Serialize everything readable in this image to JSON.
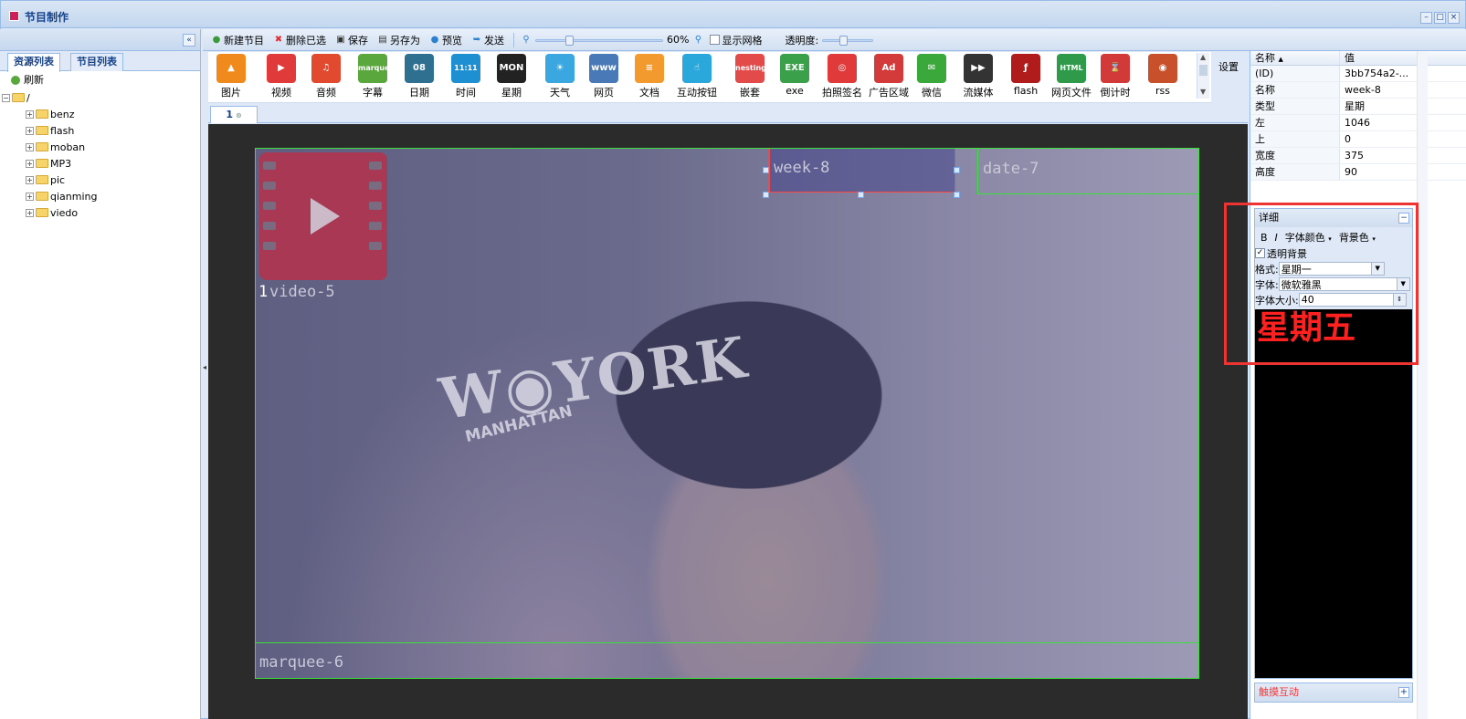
{
  "window": {
    "title": "节目制作",
    "controls": [
      "–",
      "□",
      "×"
    ]
  },
  "left_panel": {
    "collapse_glyph": "«",
    "tabs": [
      "资源列表",
      "节目列表"
    ],
    "refresh_label": "刷新",
    "root_label": "/",
    "folders": [
      "benz",
      "flash",
      "moban",
      "MP3",
      "pic",
      "qianming",
      "viedo"
    ]
  },
  "toolbar": {
    "new_program": "新建节目",
    "delete_selected": "删除已选",
    "save": "保存",
    "save_as": "另存为",
    "preview": "预览",
    "send": "发送",
    "zoom_value": "60%",
    "zoom_level": 0.25,
    "show_grid": "显示网格",
    "show_grid_checked": false,
    "opacity_label": "透明度:",
    "opacity_level": 0.4
  },
  "palette": {
    "items": [
      {
        "label": "图片",
        "icon": "picture-icon",
        "color": "#f08a1c",
        "glyph": "▲"
      },
      {
        "label": "视频",
        "icon": "video-icon",
        "color": "#e03a3a",
        "glyph": "▶"
      },
      {
        "label": "音频",
        "icon": "music-icon",
        "color": "#e24a2f",
        "glyph": "♫"
      },
      {
        "label": "字幕",
        "icon": "marquee-icon",
        "color": "#5aa83d",
        "glyph": "marquee"
      },
      {
        "label": "日期",
        "icon": "calendar-icon",
        "color": "#2f6f8f",
        "glyph": "08"
      },
      {
        "label": "时间",
        "icon": "clock-icon",
        "color": "#1e8fd0",
        "glyph": "11:11"
      },
      {
        "label": "星期",
        "icon": "weekday-icon",
        "color": "#222222",
        "glyph": "MON"
      },
      {
        "label": "天气",
        "icon": "weather-icon",
        "color": "#3aa7e0",
        "glyph": "☀"
      },
      {
        "label": "网页",
        "icon": "webpage-icon",
        "color": "#4a79b8",
        "glyph": "www"
      },
      {
        "label": "文档",
        "icon": "document-icon",
        "color": "#f29a2e",
        "glyph": "≡"
      },
      {
        "label": "互动按钮",
        "icon": "touch-button-icon",
        "color": "#2aa8dc",
        "glyph": "☝"
      },
      {
        "label": "嵌套",
        "icon": "nesting-icon",
        "color": "#e34b4b",
        "glyph": "nesting"
      },
      {
        "label": "exe",
        "icon": "exe-icon",
        "color": "#3aa14a",
        "glyph": "EXE"
      },
      {
        "label": "拍照签名",
        "icon": "camera-sign-icon",
        "color": "#e03a3a",
        "glyph": "◎"
      },
      {
        "label": "广告区域",
        "icon": "ad-icon",
        "color": "#d33a3a",
        "glyph": "Ad"
      },
      {
        "label": "微信",
        "icon": "wechat-icon",
        "color": "#3aa83a",
        "glyph": "✉"
      },
      {
        "label": "流媒体",
        "icon": "streaming-icon",
        "color": "#333333",
        "glyph": "▶▶"
      },
      {
        "label": "flash",
        "icon": "flash-icon",
        "color": "#b01c1c",
        "glyph": "ƒ"
      },
      {
        "label": "网页文件",
        "icon": "html-icon",
        "color": "#2e9a4a",
        "glyph": "HTML"
      },
      {
        "label": "倒计时",
        "icon": "hourglass-icon",
        "color": "#d23a3a",
        "glyph": "⌛"
      },
      {
        "label": "rss",
        "icon": "rss-icon",
        "color": "#c8502a",
        "glyph": "◉"
      }
    ],
    "settings_label": "设置"
  },
  "doc_tabs": [
    {
      "label": "1"
    }
  ],
  "canvas": {
    "regions": {
      "video": "video-5",
      "video_partial_visible": "1",
      "week": "week-8",
      "date": "date-7",
      "marquee": "marquee-6"
    },
    "hat_text": "W◉YORK",
    "hat_sub": "MANHATTAN"
  },
  "properties": {
    "header_name": "名称",
    "header_value": "值",
    "rows": [
      {
        "name": "(ID)",
        "value": "3bb754a2-..."
      },
      {
        "name": "名称",
        "value": "week-8"
      },
      {
        "name": "类型",
        "value": "星期"
      },
      {
        "name": "左",
        "value": "1046"
      },
      {
        "name": "上",
        "value": "0"
      },
      {
        "name": "宽度",
        "value": "375"
      },
      {
        "name": "高度",
        "value": "90"
      }
    ]
  },
  "detail": {
    "title": "详细",
    "bold": "B",
    "italic": "I",
    "font_color": "字体颜色",
    "bg_color": "背景色",
    "transparent_bg_label": "透明背景",
    "transparent_bg_checked": true,
    "format_label": "格式:",
    "format_value": "星期一",
    "font_label": "字体:",
    "font_value": "微软雅黑",
    "font_size_label": "字体大小:",
    "font_size_value": "40",
    "preview_text": "星期五",
    "preview_color": "#ff2020"
  },
  "touch": {
    "label": "触摸互动",
    "plus": "+"
  }
}
